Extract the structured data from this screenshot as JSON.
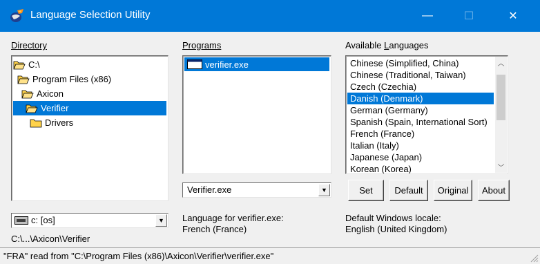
{
  "window": {
    "title": "Language Selection Utility",
    "controls": {
      "minimize": "—",
      "maximize": "☐",
      "close": "✕"
    }
  },
  "directory": {
    "label": "Directory",
    "tree": [
      {
        "label": "C:\\",
        "selected": false
      },
      {
        "label": "Program Files (x86)",
        "selected": false
      },
      {
        "label": "Axicon",
        "selected": false
      },
      {
        "label": "Verifier",
        "selected": true
      },
      {
        "label": "Drivers",
        "selected": false
      }
    ],
    "drive": "c: [os]",
    "path": "C:\\...\\Axicon\\Verifier"
  },
  "programs": {
    "label": "Programs",
    "items": [
      {
        "label": "verifier.exe",
        "selected": true
      }
    ],
    "filter": "Verifier.exe",
    "language_caption": "Language for verifier.exe:",
    "language_value": "French (France)"
  },
  "languages": {
    "label_prefix": "Available ",
    "label_underlined": "L",
    "label_suffix": "anguages",
    "items": [
      {
        "label": "Chinese (Simplified, China)",
        "selected": false
      },
      {
        "label": "Chinese (Traditional, Taiwan)",
        "selected": false
      },
      {
        "label": "Czech (Czechia)",
        "selected": false
      },
      {
        "label": "Danish (Denmark)",
        "selected": true
      },
      {
        "label": "German (Germany)",
        "selected": false
      },
      {
        "label": "Spanish (Spain, International Sort)",
        "selected": false
      },
      {
        "label": "French (France)",
        "selected": false
      },
      {
        "label": "Italian (Italy)",
        "selected": false
      },
      {
        "label": "Japanese (Japan)",
        "selected": false
      },
      {
        "label": "Korean (Korea)",
        "selected": false
      }
    ],
    "buttons": {
      "set": "Set",
      "default": "Default",
      "original": "Original",
      "about": "About"
    },
    "locale_caption": "Default Windows locale:",
    "locale_value": "English (United Kingdom)"
  },
  "status": {
    "text": "\"FRA\" read from \"C:\\Program Files (x86)\\Axicon\\Verifier\\verifier.exe\""
  },
  "colors": {
    "accent": "#0078d7",
    "face": "#f0f0f0",
    "folder": "#ffd24a"
  }
}
